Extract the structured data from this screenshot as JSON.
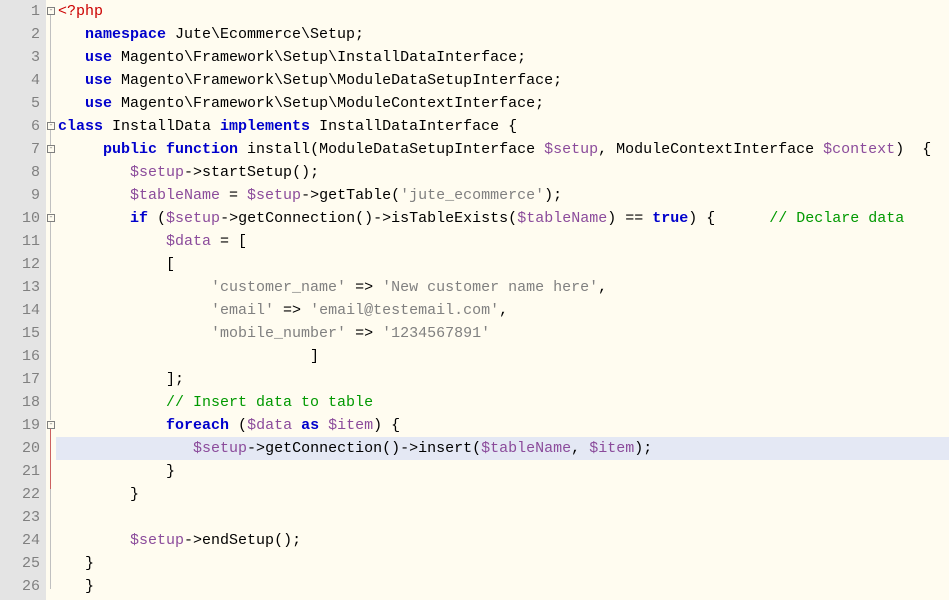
{
  "lines": {
    "count": 26,
    "highlighted": 20
  },
  "tokens": {
    "l1": {
      "open": "<?php"
    },
    "l2": {
      "kw": "namespace",
      "txt": " Jute\\Ecommerce\\Setup;"
    },
    "l3": {
      "kw": "use",
      "txt": " Magento\\Framework\\Setup\\InstallDataInterface;"
    },
    "l4": {
      "kw": "use",
      "txt": " Magento\\Framework\\Setup\\ModuleDataSetupInterface;"
    },
    "l5": {
      "kw": "use",
      "txt": " Magento\\Framework\\Setup\\ModuleContextInterface;"
    },
    "l6": {
      "kw1": "class",
      "name": " InstallData ",
      "kw2": "implements",
      "name2": " InstallDataInterface {"
    },
    "l7": {
      "kw": "public function",
      "name": " install",
      "p1": "(ModuleDataSetupInterface ",
      "v1": "$setup",
      "p2": ", ModuleContextInterface ",
      "v2": "$context",
      "p3": ")  {"
    },
    "l8": {
      "v": "$setup",
      "op": "->",
      "fn": "startSetup",
      "tail": "();"
    },
    "l9": {
      "v1": "$tableName",
      "op1": " = ",
      "v2": "$setup",
      "op2": "->",
      "fn": "getTable",
      "p1": "(",
      "str": "'jute_ecommerce'",
      "p2": ");"
    },
    "l10": {
      "kw1": "if",
      "p1": " (",
      "v1": "$setup",
      "op1": "->",
      "fn1": "getConnection",
      "p2": "()",
      "op2": "->",
      "fn2": "isTableExists",
      "p3": "(",
      "v2": "$tableName",
      "p4": ") == ",
      "kw2": "true",
      "p5": ") {      ",
      "cm": "// Declare data"
    },
    "l11": {
      "v": "$data",
      "txt": " = ["
    },
    "l12": {
      "txt": "["
    },
    "l13": {
      "k": "'customer_name'",
      "op": " => ",
      "val": "'New customer name here'",
      "tail": ","
    },
    "l14": {
      "k": "'email'",
      "op": " => ",
      "val": "'email@testemail.com'",
      "tail": ","
    },
    "l15": {
      "k": "'mobile_number'",
      "op": " => ",
      "val": "'1234567891'"
    },
    "l16": {
      "txt": "]"
    },
    "l17": {
      "txt": "];"
    },
    "l18": {
      "cm": "// Insert data to table"
    },
    "l19": {
      "kw1": "foreach",
      "p1": " (",
      "v1": "$data",
      "sp": " ",
      "kw2": "as",
      "sp2": " ",
      "v2": "$item",
      "p2": ") {"
    },
    "l20": {
      "v1": "$setup",
      "op1": "->",
      "fn1": "getConnection",
      "p1": "()",
      "op2": "->",
      "fn2": "insert",
      "p2": "(",
      "v2": "$tableName",
      "p3": ", ",
      "v3": "$item",
      "p4": ");"
    },
    "l21": {
      "txt": "}"
    },
    "l22": {
      "txt": "}"
    },
    "l24": {
      "v": "$setup",
      "op": "->",
      "fn": "endSetup",
      "tail": "();"
    },
    "l25": {
      "txt": "}"
    },
    "l26": {
      "txt": "}"
    }
  },
  "fold_markers": [
    1,
    6,
    7,
    10,
    19
  ],
  "indent": {
    "l2": "   ",
    "l3": "   ",
    "l4": "   ",
    "l5": "   ",
    "l7": "     ",
    "l8": "        ",
    "l9": "        ",
    "l10": "        ",
    "l11": "            ",
    "l12": "            ",
    "l13": "                 ",
    "l14": "                 ",
    "l15": "                 ",
    "l16": "                            ",
    "l17": "            ",
    "l18": "            ",
    "l19": "            ",
    "l20": "               ",
    "l21": "            ",
    "l22": "        ",
    "l24": "        ",
    "l25": "   ",
    "l26": "   "
  }
}
